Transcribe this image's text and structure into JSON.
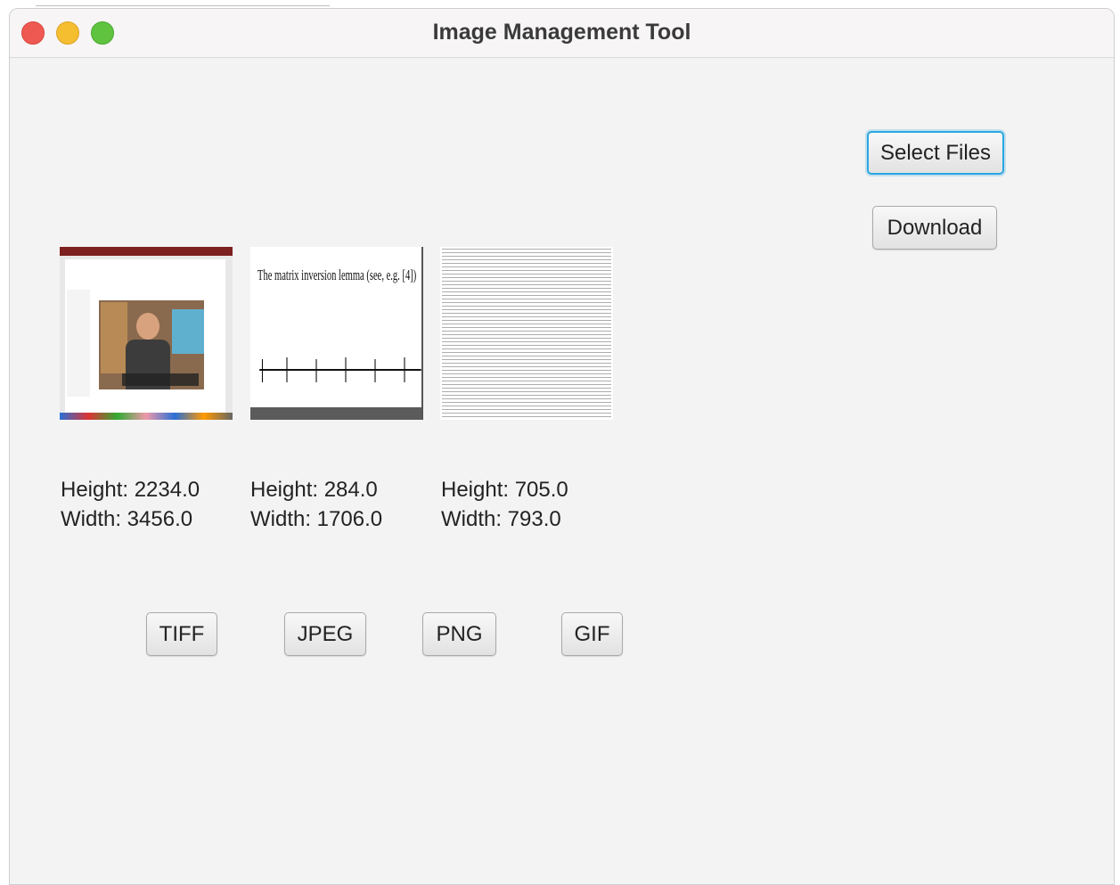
{
  "window": {
    "title": "Image Management Tool"
  },
  "actions": {
    "select_files_label": "Select Files",
    "download_label": "Download"
  },
  "images": [
    {
      "height_text": "Height: 2234.0",
      "width_text": "Width: 3456.0"
    },
    {
      "height_text": "Height: 284.0",
      "width_text": "Width: 1706.0",
      "caption": "The matrix inversion lemma (see, e.g. [4])"
    },
    {
      "height_text": "Height: 705.0",
      "width_text": "Width: 793.0"
    }
  ],
  "formats": {
    "tiff_label": "TIFF",
    "jpeg_label": "JPEG",
    "png_label": "PNG",
    "gif_label": "GIF"
  }
}
